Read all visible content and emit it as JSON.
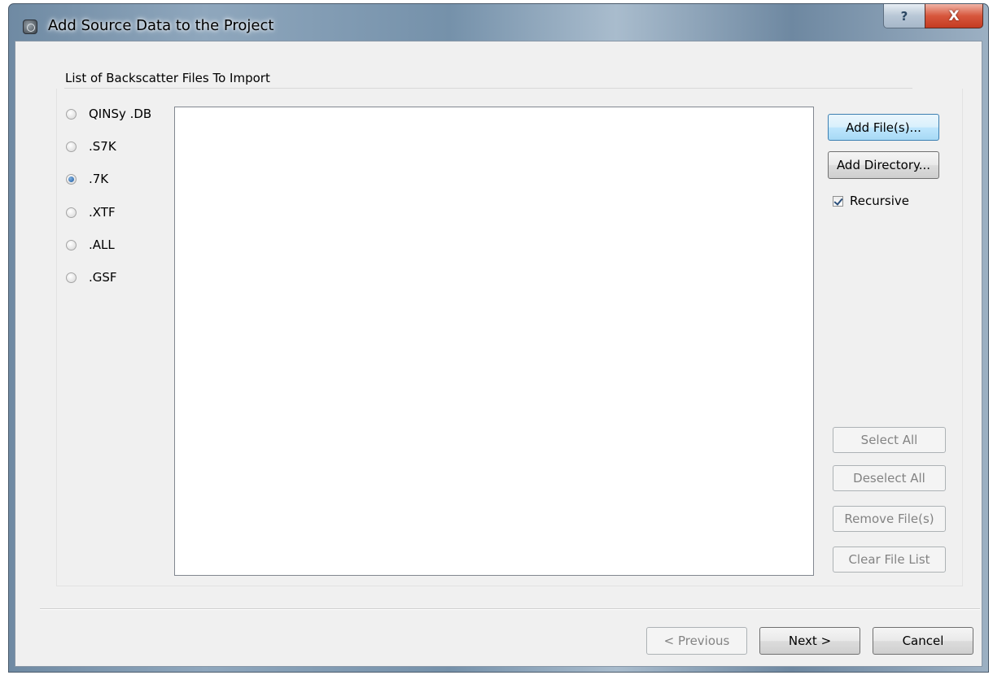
{
  "window": {
    "title": "Add Source Data to the Project",
    "help_glyph": "?",
    "close_glyph": "X"
  },
  "group": {
    "title": "List of Backscatter Files To Import"
  },
  "formats": [
    {
      "label": "QINSy .DB",
      "selected": false
    },
    {
      "label": ".S7K",
      "selected": false
    },
    {
      "label": ".7K",
      "selected": true
    },
    {
      "label": ".XTF",
      "selected": false
    },
    {
      "label": ".ALL",
      "selected": false
    },
    {
      "label": ".GSF",
      "selected": false
    }
  ],
  "file_list": {
    "items": []
  },
  "actions": {
    "add_files": "Add File(s)...",
    "add_directory": "Add Directory...",
    "recursive_label": "Recursive",
    "recursive_checked": true,
    "select_all": "Select All",
    "deselect_all": "Deselect All",
    "remove_files": "Remove File(s)",
    "clear_list": "Clear File List"
  },
  "footer": {
    "previous": "< Previous",
    "next": "Next >",
    "cancel": "Cancel"
  },
  "icons": {
    "app": "app-icon",
    "help": "help-icon",
    "close": "close-icon"
  }
}
